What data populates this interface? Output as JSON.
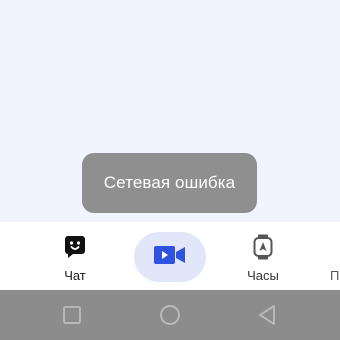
{
  "toast": {
    "message": "Сетевая ошибка"
  },
  "bottom_nav": {
    "items": [
      {
        "label": "Чат",
        "icon": "chat-icon"
      },
      {
        "label": "",
        "icon": "video-camera-icon",
        "active": true
      },
      {
        "label": "Часы",
        "icon": "watch-icon"
      },
      {
        "label": "Пр",
        "icon": ""
      }
    ]
  },
  "system_nav": {
    "buttons": [
      "recent-apps",
      "home",
      "back"
    ]
  },
  "colors": {
    "background": "#f2f4fd",
    "toast_bg": "#8f8f8f",
    "accent": "#2f52e0",
    "active_pill": "#e1e7f8",
    "system_bar": "#8c8c8c"
  }
}
